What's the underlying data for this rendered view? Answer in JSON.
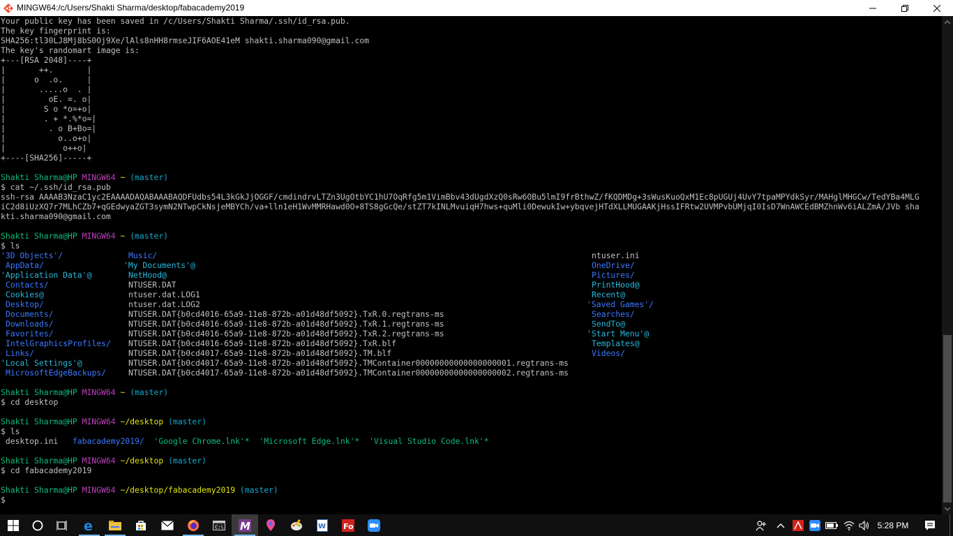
{
  "window": {
    "title": "MINGW64:/c/Users/Shakti Sharma/desktop/fabacademy2019"
  },
  "terminal": {
    "keygen_output": [
      "Your public key has been saved in /c/Users/Shakti Sharma/.ssh/id_rsa.pub.",
      "The key fingerprint is:",
      "SHA256:tl30LJ8Mj8bS0Oj9Xe/lAls8nHH8rmseJIF6AOE41eM shakti.sharma090@gmail.com",
      "The key's randomart image is:",
      "+---[RSA 2048]----+",
      "|       ++.       |",
      "|      o  .o.     |",
      "|       .....o  . |",
      "|         oE. =. o|",
      "|        S o *o=+o|",
      "|        . + *.%*o=|",
      "|         . o B+Bo=|",
      "|           o..o+o|",
      "|            o++o|",
      "+----[SHA256]-----+"
    ],
    "prompt_user": "Shakti Sharma@HP",
    "prompt_env": "MINGW64",
    "branch": "(master)",
    "prompt_symbol": "$",
    "block1": {
      "path": "~",
      "command": "cat ~/.ssh/id_rsa.pub",
      "output": [
        "ssh-rsa AAAAB3NzaC1yc2EAAAADAQABAAABAQDFUdbs54L3kGkJjOGGF/cmdindrvLTZn3UgOtbYC1hU7OqRfg5m1VimBbv43dUgdXzQ0sRw6OBu5lmI9frBthwZ/fKQDMDg+3sWusKuoQxM1Ec8pUGUj4UvY7tpaMPYdkSyr/MAHglMHGCw/TedYBa4MLG",
        "iC2d8iUzXQ7r7MLhCZb7+qGEdwyaZGT3symN2NTwpCkNsjeMBYCh/va+lln1eH1WvMMRHawd0O+8TS8gGcQe/stZT7kINLMvuiqH7hws+quMli0DewukIw+ybqvejHTdXLLMUGAAKjHssIFRtw2UVMPvbUMjqI0IsD7WnAWCEdBMZhnWv6iALZmA/JVb sha",
        "kti.sharma090@gmail.com"
      ]
    },
    "block2": {
      "path": "~",
      "command": "ls",
      "listing": [
        [
          "'3D Objects'/",
          "Music/",
          "ntuser.ini"
        ],
        [
          "AppData/",
          "'My Documents'@",
          "OneDrive/"
        ],
        [
          "'Application Data'@",
          "NetHood@",
          "Pictures/"
        ],
        [
          "Contacts/",
          "NTUSER.DAT",
          "PrintHood@"
        ],
        [
          "Cookies@",
          "ntuser.dat.LOG1",
          "Recent@"
        ],
        [
          "Desktop/",
          "ntuser.dat.LOG2",
          "'Saved Games'/"
        ],
        [
          "Documents/",
          "NTUSER.DAT{b0cd4016-65a9-11e8-872b-a01d48df5092}.TxR.0.regtrans-ms",
          "Searches/"
        ],
        [
          "Downloads/",
          "NTUSER.DAT{b0cd4016-65a9-11e8-872b-a01d48df5092}.TxR.1.regtrans-ms",
          "SendTo@"
        ],
        [
          "Favorites/",
          "NTUSER.DAT{b0cd4016-65a9-11e8-872b-a01d48df5092}.TxR.2.regtrans-ms",
          "'Start Menu'@"
        ],
        [
          "IntelGraphicsProfiles/",
          "NTUSER.DAT{b0cd4016-65a9-11e8-872b-a01d48df5092}.TxR.blf",
          "Templates@"
        ],
        [
          "Links/",
          "NTUSER.DAT{b0cd4017-65a9-11e8-872b-a01d48df5092}.TM.blf",
          "Videos/"
        ],
        [
          "'Local Settings'@",
          "NTUSER.DAT{b0cd4017-65a9-11e8-872b-a01d48df5092}.TMContainer00000000000000000001.regtrans-ms",
          ""
        ],
        [
          "MicrosoftEdgeBackups/",
          "NTUSER.DAT{b0cd4017-65a9-11e8-872b-a01d48df5092}.TMContainer00000000000000000002.regtrans-ms",
          ""
        ]
      ]
    },
    "block3": {
      "path": "~",
      "command": "cd desktop"
    },
    "block4": {
      "path": "~/desktop",
      "command": "ls",
      "listing": [
        "desktop.ini",
        "fabacademy2019/",
        "'Google Chrome.lnk'*",
        "'Microsoft Edge.lnk'*",
        "'Visual Studio Code.lnk'*"
      ]
    },
    "block5": {
      "path": "~/desktop",
      "command": "cd fabacademy2019"
    },
    "block6": {
      "path": "~/desktop/fabacademy2019"
    }
  },
  "taskbar": {
    "pinned": [
      "windows-start-icon",
      "cortana-circle-icon",
      "task-view-icon",
      "edge-browser-icon",
      "file-explorer-icon",
      "store-icon",
      "mail-icon",
      "firefox-icon",
      "terminal-app-icon",
      "mingw-icon",
      "maps-pin-icon",
      "paint-icon",
      "writer-icon",
      "acrobat-icon",
      "zoom-icon"
    ],
    "clock": "5:28 PM",
    "colors": {
      "background": "#101010",
      "active": "#3a3a3a",
      "accent": "#76b9ed"
    }
  },
  "colors": {
    "prompt_user": "#0dbc79",
    "prompt_env": "#bc3fbc",
    "path": "#e5e510",
    "branch": "#11a8cd",
    "directory": "#3b78ff",
    "symlink": "#29b8db",
    "text": "#c0c0c0"
  }
}
